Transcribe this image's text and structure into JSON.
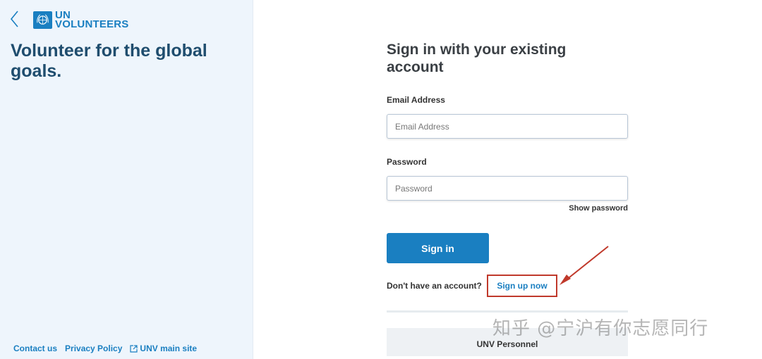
{
  "brand": {
    "logo_line1": "UN",
    "logo_line2": "VOLUNTEERS",
    "tagline": "Volunteer for the global goals."
  },
  "footer": {
    "contact": "Contact us",
    "privacy": "Privacy Policy",
    "main_site": "UNV main site"
  },
  "form": {
    "heading": "Sign in with your existing account",
    "email_label": "Email Address",
    "email_placeholder": "Email Address",
    "email_value": "",
    "password_label": "Password",
    "password_placeholder": "Password",
    "password_value": "",
    "show_password": "Show password",
    "signin_button": "Sign in",
    "no_account_text": "Don't have an account?",
    "signup_link": "Sign up now",
    "unv_personnel_button": "UNV Personnel"
  },
  "watermark": "知乎 @宁沪有你志愿同行",
  "colors": {
    "accent": "#1a7fc1",
    "left_panel_bg": "#eef5fc",
    "heading": "#1f4d6e",
    "annotation": "#c0392b"
  },
  "icons": {
    "back": "chevron-left-icon",
    "logo": "un-emblem-icon",
    "external_link": "external-link-icon"
  }
}
